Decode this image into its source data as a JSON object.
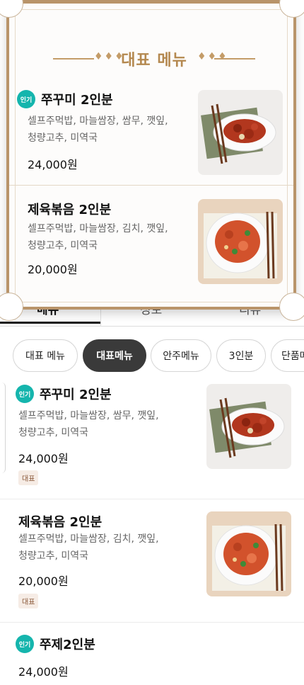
{
  "tabs": [
    "메뉴",
    "정보",
    "리뷰"
  ],
  "chips": [
    "대표 메뉴",
    "대표메뉴",
    "안주메뉴",
    "3인분",
    "단품메"
  ],
  "active_chip_index": 1,
  "popup": {
    "title": "대표 메뉴",
    "items": [
      {
        "badge": "인기",
        "name": "쭈꾸미 2인분",
        "desc_line1": "셀프주먹밥, 마늘쌈장, 쌈무, 깻잎,",
        "desc_line2": "청량고추, 미역국",
        "price": "24,000원",
        "image": "spicy-webfoot-octopus-plate"
      },
      {
        "name": "제육볶음 2인분",
        "desc_line1": "셀프주먹밥, 마늘쌈장, 김치, 깻잎,",
        "desc_line2": "청량고추, 미역국",
        "price": "20,000원",
        "image": "spicy-stir-fried-pork-plate"
      }
    ]
  },
  "menu": [
    {
      "badge": "인기",
      "name": "쭈꾸미 2인분",
      "desc_line1": "셀프주먹밥, 마늘쌈장, 쌈무, 깻잎,",
      "desc_line2": "청량고추, 미역국",
      "price": "24,000원",
      "tag": "대표",
      "image": "spicy-webfoot-octopus-plate"
    },
    {
      "name": "제육볶음 2인분",
      "desc_line1": "셀프주먹밥, 마늘쌈장, 김치, 깻잎,",
      "desc_line2": "청량고추, 미역국",
      "price": "20,000원",
      "tag": "대표",
      "image": "spicy-stir-fried-pork-plate"
    },
    {
      "badge": "인기",
      "name": "쭈제2인분",
      "price": "24,000원"
    }
  ],
  "colors": {
    "popup_frame": "#b9946a",
    "popup_title": "#b4884f",
    "badge_teal": "#15b5ad",
    "active_chip": "#3a3a3a",
    "tag_text": "#8b5a3c",
    "tag_bg": "#f6ece5"
  }
}
